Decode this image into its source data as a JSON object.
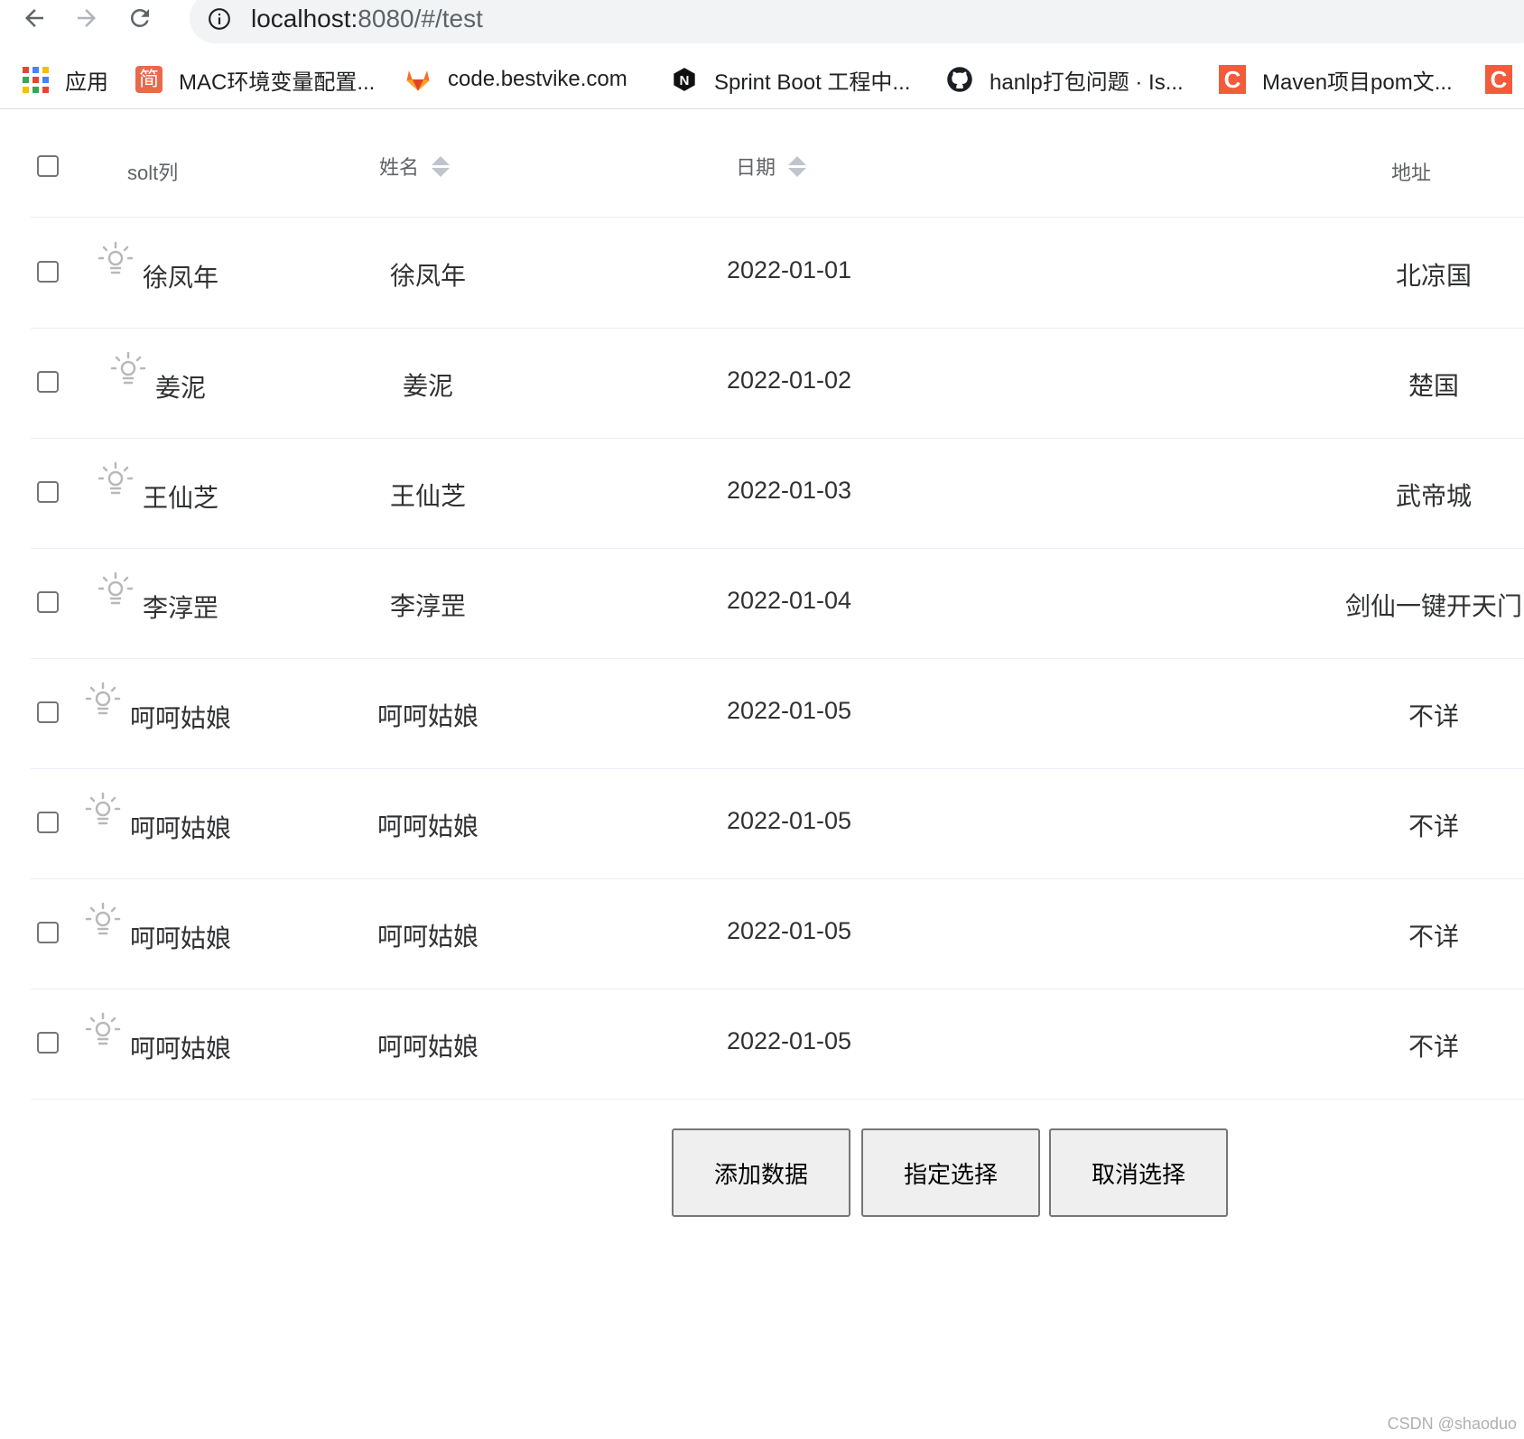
{
  "browser": {
    "url_host": "localhost:",
    "url_path": "8080/#/test",
    "bookmarks": [
      {
        "label": "应用",
        "icon": "apps-grid-icon"
      },
      {
        "label": "MAC环境变量配置...",
        "icon": "jianshu-icon",
        "icon_text": "简"
      },
      {
        "label": "code.bestvike.com",
        "icon": "gitlab-icon"
      },
      {
        "label": "Sprint Boot 工程中...",
        "icon": "n-logo-icon",
        "icon_text": "N"
      },
      {
        "label": "hanlp打包问题 · Is...",
        "icon": "github-icon"
      },
      {
        "label": "Maven项目pom文...",
        "icon": "csdn-icon",
        "icon_text": "C"
      },
      {
        "label": "",
        "icon": "csdn-icon",
        "icon_text": "C"
      }
    ]
  },
  "table": {
    "headers": {
      "slot": "solt列",
      "name": "姓名",
      "date": "日期",
      "address": "地址"
    },
    "rows": [
      {
        "slot_name": "徐凤年",
        "name": "徐凤年",
        "date": "2022-01-01",
        "address": "北凉国"
      },
      {
        "slot_name": "姜泥",
        "name": "姜泥",
        "date": "2022-01-02",
        "address": "楚国"
      },
      {
        "slot_name": "王仙芝",
        "name": "王仙芝",
        "date": "2022-01-03",
        "address": "武帝城"
      },
      {
        "slot_name": "李淳罡",
        "name": "李淳罡",
        "date": "2022-01-04",
        "address": "剑仙一键开天门"
      },
      {
        "slot_name": "呵呵姑娘",
        "name": "呵呵姑娘",
        "date": "2022-01-05",
        "address": "不详"
      },
      {
        "slot_name": "呵呵姑娘",
        "name": "呵呵姑娘",
        "date": "2022-01-05",
        "address": "不详"
      },
      {
        "slot_name": "呵呵姑娘",
        "name": "呵呵姑娘",
        "date": "2022-01-05",
        "address": "不详"
      },
      {
        "slot_name": "呵呵姑娘",
        "name": "呵呵姑娘",
        "date": "2022-01-05",
        "address": "不详"
      }
    ]
  },
  "buttons": {
    "add": "添加数据",
    "select": "指定选择",
    "clear": "取消选择"
  },
  "watermark": "CSDN @shaoduo",
  "colors": {
    "border": "#ebeef5",
    "text": "#303133",
    "header_text": "#606266",
    "sort_arrow": "#c0c4cc"
  }
}
